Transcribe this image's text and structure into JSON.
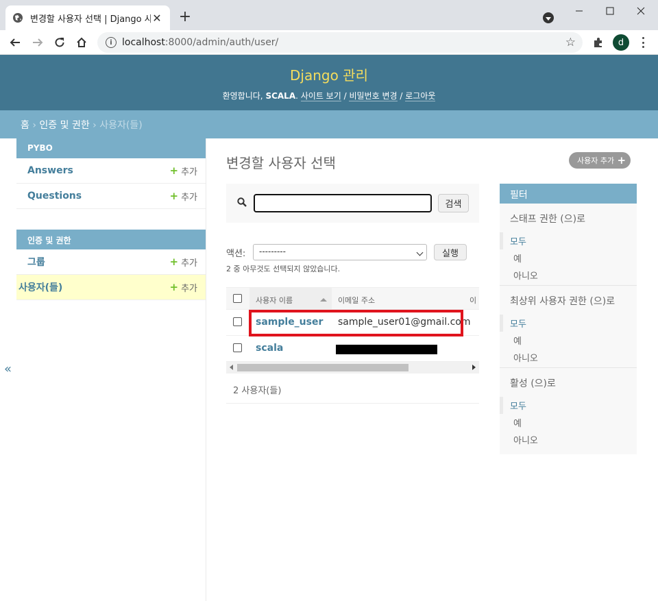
{
  "browser": {
    "tab_title": "변경할 사용자 선택 | Django 사이",
    "url_host": "localhost",
    "url_rest": ":8000/admin/auth/user/",
    "avatar_letter": "d"
  },
  "header": {
    "branding": "Django 관리",
    "welcome": "환영합니다,",
    "username": "SCALA",
    "view_site": "사이트 보기",
    "change_password": "비밀번호 변경",
    "logout": "로그아웃",
    "sep": "/"
  },
  "breadcrumbs": {
    "home": "홈",
    "app": "인증 및 권한",
    "current": "사용자(들)",
    "sep": "›"
  },
  "sidebar": {
    "modules": [
      {
        "caption": "PYBO",
        "models": [
          {
            "label": "Answers",
            "add": "추가"
          },
          {
            "label": "Questions",
            "add": "추가"
          }
        ]
      },
      {
        "caption": "인증 및 권한",
        "models": [
          {
            "label": "그룹",
            "add": "추가"
          },
          {
            "label": "사용자(들)",
            "add": "추가"
          }
        ]
      }
    ],
    "collapse": "«"
  },
  "content": {
    "title": "변경할 사용자 선택",
    "add_button": "사용자 추가",
    "search_button": "검색",
    "search_value": "",
    "actions_label": "액션:",
    "actions_selected": "---------",
    "run_button": "실행",
    "action_counter": "2 중 아무것도 선택되지 않았습니다.",
    "columns": [
      "사용자 이름",
      "이메일 주소",
      "이"
    ],
    "rows": [
      {
        "username": "sample_user",
        "email": "sample_user01@gmail.com"
      },
      {
        "username": "scala",
        "email": ""
      }
    ],
    "paginator": "2 사용자(들)"
  },
  "filter": {
    "title": "필터",
    "groups": [
      {
        "title": "스태프 권한 (으)로",
        "options": [
          "모두",
          "예",
          "아니오"
        ]
      },
      {
        "title": "최상위 사용자 권한 (으)로",
        "options": [
          "모두",
          "예",
          "아니오"
        ]
      },
      {
        "title": "활성 (으)로",
        "options": [
          "모두",
          "예",
          "아니오"
        ]
      }
    ]
  },
  "colors": {
    "header_bg": "#417690",
    "branding": "#f5dd5d",
    "module_bg": "#79aec8",
    "link": "#447e9b",
    "highlight": "#e0141d",
    "current_row": "#ffffcc"
  }
}
